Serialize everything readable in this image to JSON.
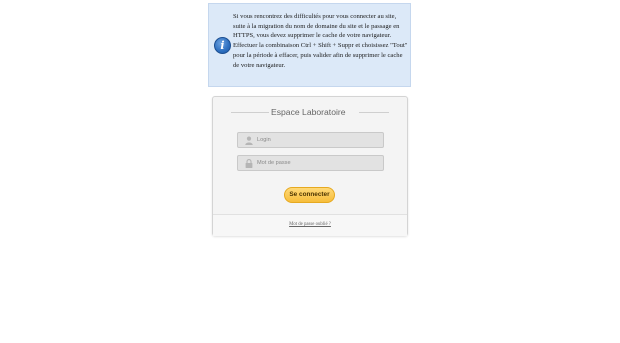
{
  "notice": {
    "icon": "info-icon",
    "icon_glyph": "i",
    "color": "#dce9f8",
    "text": "Si vous rencontrez des difficultés pour vous connecter au site, suite à la migration du nom de domaine du site et le passage en HTTPS, vous devez supprimer le cache de votre navigateur.\nEffectuer la combinaison Ctrl + Shift + Suppr et choisissez \"Tout\" pour la période à effacer, puis valider afin de supprimer le cache de votre navigateur."
  },
  "login_panel": {
    "title": "Espace Laboratoire",
    "login_field": {
      "icon": "user-icon",
      "placeholder": "Login",
      "value": ""
    },
    "password_field": {
      "icon": "lock-icon",
      "placeholder": "Mot de passe",
      "value": ""
    },
    "connect_button": {
      "label": "Se connecter",
      "color": "#f6bd3b"
    },
    "forgot_link": "Mot de passe oublié ?"
  }
}
